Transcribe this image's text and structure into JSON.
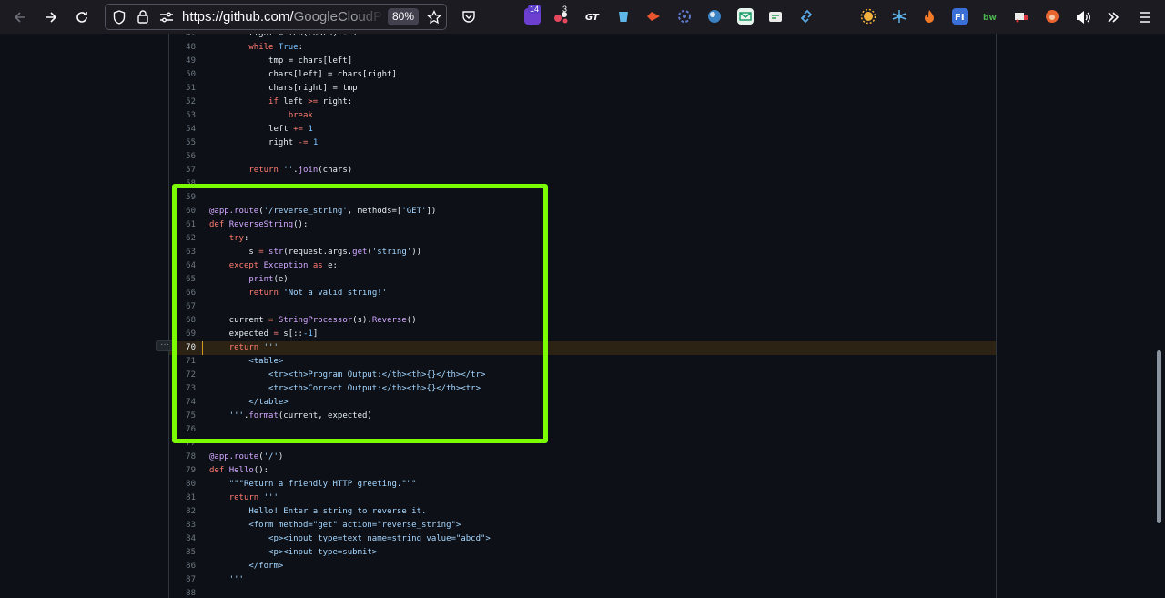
{
  "browser": {
    "url_host": "https://github.com/",
    "url_rest": "GoogleCloudPl",
    "zoom": "80%",
    "badges": {
      "ext1": "14",
      "ext2": "3"
    }
  },
  "code": {
    "lines": [
      {
        "n": "47",
        "html": "        right = len(chars) - 1"
      },
      {
        "n": "48",
        "html": "        <span class=\"kw\">while</span> <span class=\"num\">True</span>:"
      },
      {
        "n": "49",
        "html": "            tmp = chars[left]"
      },
      {
        "n": "50",
        "html": "            chars[left] = chars[right]"
      },
      {
        "n": "51",
        "html": "            chars[right] = tmp"
      },
      {
        "n": "52",
        "html": "            <span class=\"kw\">if</span> left <span class=\"kw\">&gt;=</span> right:"
      },
      {
        "n": "53",
        "html": "                <span class=\"kw\">break</span>"
      },
      {
        "n": "54",
        "html": "            left <span class=\"kw\">+=</span> <span class=\"num\">1</span>"
      },
      {
        "n": "55",
        "html": "            right <span class=\"kw\">-=</span> <span class=\"num\">1</span>"
      },
      {
        "n": "56",
        "html": ""
      },
      {
        "n": "57",
        "html": "        <span class=\"kw\">return</span> <span class=\"str\">''</span>.<span class=\"fn\">join</span>(chars)"
      },
      {
        "n": "58",
        "html": ""
      },
      {
        "n": "59",
        "html": ""
      },
      {
        "n": "60",
        "html": "<span class=\"dec\">@app.route</span>(<span class=\"str\">'/reverse_string'</span>, methods=[<span class=\"str\">'GET'</span>])"
      },
      {
        "n": "61",
        "html": "<span class=\"kw\">def</span> <span class=\"fn\">ReverseString</span>():"
      },
      {
        "n": "62",
        "html": "    <span class=\"kw\">try</span>:"
      },
      {
        "n": "63",
        "html": "        s <span class=\"kw\">=</span> <span class=\"fn\">str</span>(request.args.<span class=\"fn\">get</span>(<span class=\"str\">'string'</span>))"
      },
      {
        "n": "64",
        "html": "    <span class=\"kw\">except</span> <span class=\"fn\">Exception</span> <span class=\"kw\">as</span> e:"
      },
      {
        "n": "65",
        "html": "        <span class=\"fn\">print</span>(e)"
      },
      {
        "n": "66",
        "html": "        <span class=\"kw\">return</span> <span class=\"str\">'Not a valid string!'</span>"
      },
      {
        "n": "67",
        "html": ""
      },
      {
        "n": "68",
        "html": "    current <span class=\"kw\">=</span> <span class=\"fn\">StringProcessor</span>(s).<span class=\"fn\">Reverse</span>()"
      },
      {
        "n": "69",
        "html": "    expected <span class=\"kw\">=</span> s[::<span class=\"num\">-1</span>]"
      },
      {
        "n": "70",
        "html": "    <span class=\"kw\">return</span> <span class=\"str\">'''</span>",
        "hl": true
      },
      {
        "n": "71",
        "html": "<span class=\"str\">        &lt;table&gt;</span>"
      },
      {
        "n": "72",
        "html": "<span class=\"str\">            &lt;tr&gt;&lt;th&gt;Program Output:&lt;/th&gt;&lt;th&gt;{}&lt;/th&gt;&lt;/tr&gt;</span>"
      },
      {
        "n": "73",
        "html": "<span class=\"str\">            &lt;tr&gt;&lt;th&gt;Correct Output:&lt;/th&gt;&lt;th&gt;{}&lt;/th&gt;&lt;tr&gt;</span>"
      },
      {
        "n": "74",
        "html": "<span class=\"str\">        &lt;/table&gt;</span>"
      },
      {
        "n": "75",
        "html": "<span class=\"str\">    '''</span>.<span class=\"fn\">format</span>(current, expected)"
      },
      {
        "n": "76",
        "html": ""
      },
      {
        "n": "77",
        "html": ""
      },
      {
        "n": "78",
        "html": "<span class=\"dec\">@app.route</span>(<span class=\"str\">'/'</span>)"
      },
      {
        "n": "79",
        "html": "<span class=\"kw\">def</span> <span class=\"fn\">Hello</span>():"
      },
      {
        "n": "80",
        "html": "    <span class=\"str\">\"\"\"Return a friendly HTTP greeting.\"\"\"</span>"
      },
      {
        "n": "81",
        "html": "    <span class=\"kw\">return</span> <span class=\"str\">'''</span>"
      },
      {
        "n": "82",
        "html": "<span class=\"str\">        Hello! Enter a string to reverse it.</span>"
      },
      {
        "n": "83",
        "html": "<span class=\"str\">        &lt;form method=\"get\" action=\"reverse_string\"&gt;</span>"
      },
      {
        "n": "84",
        "html": "<span class=\"str\">            &lt;p&gt;&lt;input type=text name=string value=\"abcd\"&gt;</span>"
      },
      {
        "n": "85",
        "html": "<span class=\"str\">            &lt;p&gt;&lt;input type=submit&gt;</span>"
      },
      {
        "n": "86",
        "html": "<span class=\"str\">        &lt;/form&gt;</span>"
      },
      {
        "n": "87",
        "html": "<span class=\"str\">    '''</span>"
      },
      {
        "n": "88",
        "html": ""
      }
    ],
    "more_button": "···"
  },
  "colors": {
    "highlight_box": "#7cfc00",
    "highlight_line": "#2c2314"
  }
}
